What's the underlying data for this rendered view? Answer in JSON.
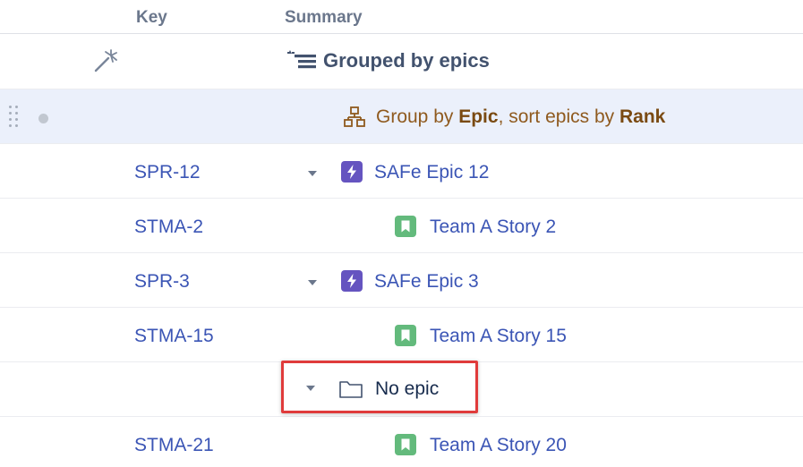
{
  "columns": {
    "key": "Key",
    "summary": "Summary"
  },
  "grouped": {
    "title": "Grouped by epics",
    "icon": "wand-icon"
  },
  "group_rule": {
    "prefix": "Group by ",
    "field": "Epic",
    "middle": ", sort epics by ",
    "sort_field": "Rank",
    "icon": "hierarchy-icon"
  },
  "rows": [
    {
      "key": "SPR-12",
      "type": "epic",
      "title": "SAFe Epic 12",
      "expanded": true
    },
    {
      "key": "STMA-2",
      "type": "story",
      "title": "Team A Story 2"
    },
    {
      "key": "SPR-3",
      "type": "epic",
      "title": "SAFe Epic 3",
      "expanded": true
    },
    {
      "key": "STMA-15",
      "type": "story",
      "title": "Team A Story 15"
    },
    {
      "key": "",
      "type": "folder",
      "title": "No epic",
      "expanded": true
    },
    {
      "key": "STMA-21",
      "type": "story",
      "title": "Team A Story 20"
    }
  ],
  "colors": {
    "epic_icon": "#6554c0",
    "story_icon": "#63ba7c",
    "link_text": "#3b55b5",
    "group_text": "#8f5a1f",
    "highlight_border": "#e03b3b",
    "group_row_bg": "#ebf0fb"
  }
}
